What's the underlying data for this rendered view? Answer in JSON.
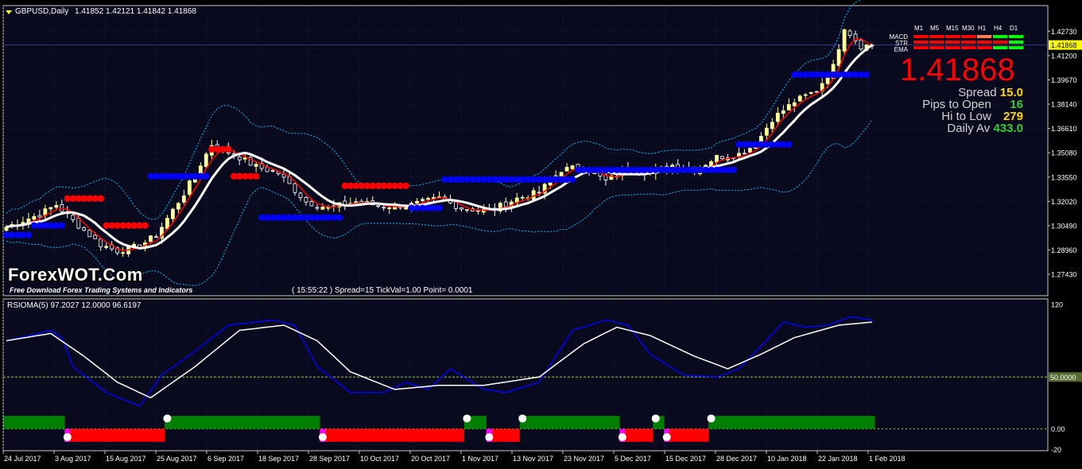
{
  "chart_header": {
    "symbol_label": "GBPUSD,Daily",
    "ohlc": "1.41852 1.42121 1.41842 1.41868"
  },
  "price_axis": {
    "ticks": [
      "1.42730",
      "1.41868",
      "1.41200",
      "1.39670",
      "1.38140",
      "1.36610",
      "1.35080",
      "1.33550",
      "1.32020",
      "1.30490",
      "1.28960",
      "1.27430"
    ],
    "current_price_label": "1.41868",
    "current_price_color": "#ffff00"
  },
  "date_axis": {
    "ticks": [
      "24 Jul 2017",
      "3 Aug 2017",
      "15 Aug 2017",
      "25 Aug 2017",
      "6 Sep 2017",
      "18 Sep 2017",
      "28 Sep 2017",
      "10 Oct 2017",
      "20 Oct 2017",
      "1 Nov 2017",
      "13 Nov 2017",
      "23 Nov 2017",
      "5 Dec 2017",
      "15 Dec 2017",
      "28 Dec 2017",
      "10 Jan 2018",
      "22 Jan 2018",
      "1 Feb 2018"
    ]
  },
  "dashboard": {
    "timeframes": [
      "M1",
      "M5",
      "M15",
      "M30",
      "H1",
      "H4",
      "D1"
    ],
    "rows": [
      {
        "name": "MACD",
        "colors": [
          "#ff0000",
          "#ff0000",
          "#ff0000",
          "#ff0000",
          "#ff7f50",
          "#00ff00",
          "#00ff00"
        ]
      },
      {
        "name": "STR",
        "colors": [
          "#ff0000",
          "#ff0000",
          "#ff0000",
          "#ff0000",
          "#ff0000",
          "#ff0000",
          "#00ff00"
        ]
      },
      {
        "name": "EMA",
        "colors": [
          "#ff0000",
          "#ff0000",
          "#ff0000",
          "#ff0000",
          "#ff0000",
          "#00ff00",
          "#00ff00"
        ]
      }
    ],
    "price": "1.41868",
    "spread_label": "Spread",
    "spread_value": "15.0",
    "pips_label": "Pips to Open",
    "pips_value": "16",
    "hilo_label": "Hi to Low",
    "hilo_value": "279",
    "adr_label": "Daily Av",
    "adr_value": "433.0"
  },
  "branding": {
    "logo": "ForexWOT.Com",
    "tagline": "Free Download Forex Trading Systems and Indicators"
  },
  "status_line": "( 15:55:22 )  Spread=15  TickVal=1.00  Point= 0.0001",
  "indicator": {
    "label": "RSIOMA(5) 97.2027 12.0000 96.6197",
    "axis_ticks": [
      "120",
      "50.0000",
      "0.00",
      "-20"
    ],
    "level_label": "50.0000"
  },
  "colors": {
    "background": "#000000",
    "chart_bg": "#0a0a1e",
    "frame": "#c8c8c8",
    "grid": "#1a1a6e",
    "bull_candle": "#ffff99",
    "bear_candle": "#ffffff",
    "supertrend_up": "#0000ff",
    "supertrend_down": "#ff0000",
    "ma_white": "#ffffff",
    "ma_red": "#ff0000",
    "bands": "#00bfff",
    "rsi_line": "#0000ff",
    "signal_line": "#ffffff",
    "hist_green": "#008000",
    "hist_red": "#ff0000",
    "hist_magenta": "#ff00ff"
  },
  "chart_data": [
    {
      "type": "line",
      "title": "",
      "ylim": [
        1.2743,
        1.435
      ],
      "x_ticks": [
        "24 Jul 2017",
        "3 Aug 2017",
        "15 Aug 2017",
        "25 Aug 2017",
        "6 Sep 2017",
        "18 Sep 2017",
        "28 Sep 2017",
        "10 Oct 2017",
        "20 Oct 2017",
        "1 Nov 2017",
        "13 Nov 2017",
        "23 Nov 2017",
        "5 Dec 2017",
        "15 Dec 2017",
        "28 Dec 2017",
        "10 Jan 2018",
        "22 Jan 2018",
        "1 Feb 2018"
      ],
      "price_keypoints": [
        [
          0,
          1.304
        ],
        [
          6,
          1.312
        ],
        [
          9,
          1.318
        ],
        [
          12,
          1.308
        ],
        [
          17,
          1.293
        ],
        [
          20,
          1.289
        ],
        [
          24,
          1.292
        ],
        [
          27,
          1.299
        ],
        [
          32,
          1.325
        ],
        [
          37,
          1.356
        ],
        [
          42,
          1.348
        ],
        [
          45,
          1.342
        ],
        [
          49,
          1.338
        ],
        [
          54,
          1.32
        ],
        [
          58,
          1.316
        ],
        [
          63,
          1.32
        ],
        [
          68,
          1.317
        ],
        [
          73,
          1.318
        ],
        [
          78,
          1.322
        ],
        [
          82,
          1.316
        ],
        [
          87,
          1.314
        ],
        [
          92,
          1.322
        ],
        [
          96,
          1.326
        ],
        [
          100,
          1.34
        ],
        [
          104,
          1.342
        ],
        [
          108,
          1.333
        ],
        [
          112,
          1.341
        ],
        [
          116,
          1.338
        ],
        [
          120,
          1.343
        ],
        [
          124,
          1.34
        ],
        [
          128,
          1.348
        ],
        [
          132,
          1.35
        ],
        [
          135,
          1.356
        ],
        [
          138,
          1.372
        ],
        [
          142,
          1.383
        ],
        [
          146,
          1.39
        ],
        [
          149,
          1.405
        ],
        [
          151,
          1.43
        ],
        [
          154,
          1.418
        ],
        [
          156,
          1.4187
        ]
      ],
      "supertrend_blocks": [
        {
          "from": 0,
          "to": 4,
          "trend": "up",
          "level": 1.299
        },
        {
          "from": 5,
          "to": 10,
          "trend": "up",
          "level": 1.305
        },
        {
          "from": 11,
          "to": 17,
          "trend": "down",
          "level": 1.322
        },
        {
          "from": 18,
          "to": 25,
          "trend": "down",
          "level": 1.305
        },
        {
          "from": 26,
          "to": 36,
          "trend": "up",
          "level": 1.336
        },
        {
          "from": 37,
          "to": 40,
          "trend": "down",
          "level": 1.353
        },
        {
          "from": 41,
          "to": 45,
          "trend": "down",
          "level": 1.336
        },
        {
          "from": 46,
          "to": 60,
          "trend": "up",
          "level": 1.31
        },
        {
          "from": 61,
          "to": 72,
          "trend": "down",
          "level": 1.33
        },
        {
          "from": 73,
          "to": 78,
          "trend": "up",
          "level": 1.316
        },
        {
          "from": 79,
          "to": 91,
          "trend": "up",
          "level": 1.334
        },
        {
          "from": 92,
          "to": 102,
          "trend": "up",
          "level": 1.334
        },
        {
          "from": 103,
          "to": 122,
          "trend": "up",
          "level": 1.34
        },
        {
          "from": 123,
          "to": 131,
          "trend": "up",
          "level": 1.34
        },
        {
          "from": 132,
          "to": 141,
          "trend": "up",
          "level": 1.356
        },
        {
          "from": 142,
          "to": 155,
          "trend": "up",
          "level": 1.4
        }
      ]
    },
    {
      "type": "line",
      "title": "",
      "ylim": [
        -20,
        120
      ],
      "series": [
        {
          "name": "RSIOMA(5)",
          "keypoints": [
            [
              0,
              85
            ],
            [
              8,
              95
            ],
            [
              10,
              88
            ],
            [
              12,
              60
            ],
            [
              18,
              35
            ],
            [
              24,
              22
            ],
            [
              28,
              52
            ],
            [
              34,
              75
            ],
            [
              40,
              100
            ],
            [
              48,
              105
            ],
            [
              52,
              100
            ],
            [
              56,
              60
            ],
            [
              62,
              35
            ],
            [
              68,
              35
            ],
            [
              72,
              45
            ],
            [
              76,
              38
            ],
            [
              80,
              58
            ],
            [
              86,
              38
            ],
            [
              90,
              35
            ],
            [
              96,
              45
            ],
            [
              102,
              95
            ],
            [
              108,
              105
            ],
            [
              112,
              100
            ],
            [
              116,
              72
            ],
            [
              122,
              52
            ],
            [
              128,
              50
            ],
            [
              132,
              58
            ],
            [
              136,
              80
            ],
            [
              140,
              103
            ],
            [
              144,
              98
            ],
            [
              148,
              100
            ],
            [
              152,
              108
            ],
            [
              156,
              105
            ]
          ]
        },
        {
          "name": "",
          "keypoints": [
            [
              0,
              85
            ],
            [
              8,
              92
            ],
            [
              14,
              70
            ],
            [
              20,
              45
            ],
            [
              26,
              30
            ],
            [
              34,
              60
            ],
            [
              42,
              95
            ],
            [
              50,
              100
            ],
            [
              56,
              85
            ],
            [
              62,
              55
            ],
            [
              70,
              38
            ],
            [
              78,
              42
            ],
            [
              86,
              42
            ],
            [
              96,
              50
            ],
            [
              104,
              82
            ],
            [
              110,
              98
            ],
            [
              116,
              90
            ],
            [
              124,
              70
            ],
            [
              130,
              58
            ],
            [
              136,
              72
            ],
            [
              142,
              88
            ],
            [
              150,
              100
            ],
            [
              156,
              103
            ]
          ]
        }
      ],
      "histogram": [
        {
          "from": 0,
          "to": 10,
          "color": "green"
        },
        {
          "from": 11,
          "to": 28,
          "color": "red"
        },
        {
          "from": 29,
          "to": 56,
          "color": "green"
        },
        {
          "from": 57,
          "to": 82,
          "color": "red"
        },
        {
          "from": 83,
          "to": 86,
          "color": "green"
        },
        {
          "from": 87,
          "to": 92,
          "color": "red"
        },
        {
          "from": 93,
          "to": 110,
          "color": "green"
        },
        {
          "from": 111,
          "to": 116,
          "color": "red"
        },
        {
          "from": 117,
          "to": 118,
          "color": "green"
        },
        {
          "from": 119,
          "to": 126,
          "color": "red"
        },
        {
          "from": 127,
          "to": 156,
          "color": "green"
        }
      ]
    }
  ]
}
